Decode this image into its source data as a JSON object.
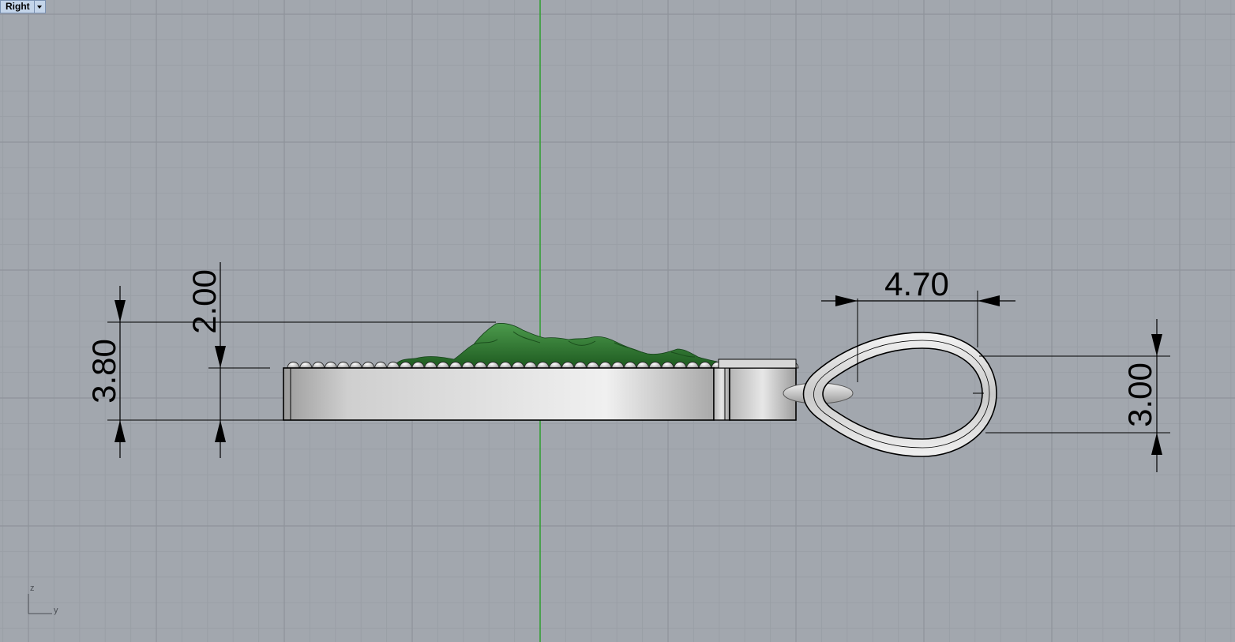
{
  "viewport": {
    "name": "Right",
    "background": "#a2a7ae",
    "minor_grid_color": "#9a9fa6",
    "major_grid_color": "#8e939a",
    "vertical_axis_color": "#2fa02f"
  },
  "dimensions": {
    "total_height": "3.80",
    "relief_height": "2.00",
    "bail_width": "4.70",
    "bail_height": "3.00"
  },
  "axis_icon": {
    "z_label": "z",
    "y_label": "y"
  },
  "colors": {
    "relief": "#2e7a30",
    "metal_light": "#ececec",
    "metal_dark": "#9c9c9c",
    "outline": "#000000"
  }
}
